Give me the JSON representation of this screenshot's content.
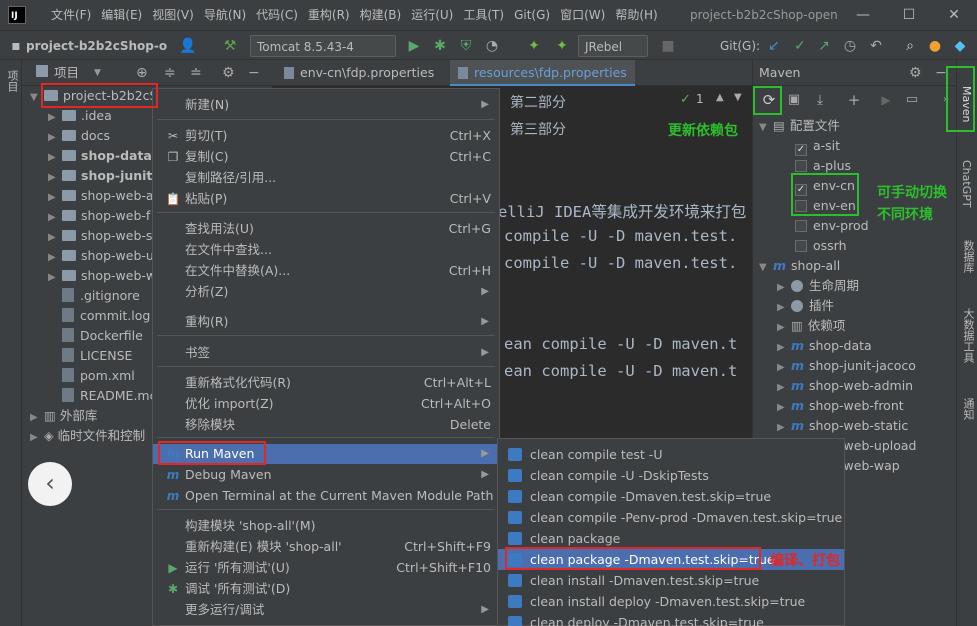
{
  "titlebar": {
    "logo": "IJ",
    "menu": [
      "文件(F)",
      "编辑(E)",
      "视图(V)",
      "导航(N)",
      "代码(C)",
      "重构(R)",
      "构建(B)",
      "运行(U)",
      "工具(T)",
      "Git(G)",
      "窗口(W)",
      "帮助(H)"
    ],
    "window_title": "project-b2b2cShop-open",
    "minimize": "—",
    "maximize": "☐",
    "close": "✕"
  },
  "toolbar": {
    "project_name": "project-b2b2cShop-ope",
    "run_config": "Tomcat 8.5.43-4",
    "jrebel": "JRebel",
    "git_label": "Git(G):"
  },
  "left_strip": {
    "project_tab": "项目"
  },
  "right_strip": {
    "maven_tab": "Maven",
    "chatgpt_tab": "ChatGPT",
    "db_tab": "数据库",
    "bigdata_tab": "大数据工具",
    "notify_tab": "通知"
  },
  "project_panel": {
    "header": "项目",
    "root": "project-b2b2cS",
    "items": [
      {
        "label": ".idea",
        "kind": "folder",
        "bold": false
      },
      {
        "label": "docs",
        "kind": "folder",
        "bold": false
      },
      {
        "label": "shop-data",
        "kind": "folder",
        "bold": true
      },
      {
        "label": "shop-junit-",
        "kind": "folder",
        "bold": true
      },
      {
        "label": "shop-web-a",
        "kind": "folder",
        "bold": false
      },
      {
        "label": "shop-web-f",
        "kind": "folder",
        "bold": false
      },
      {
        "label": "shop-web-s",
        "kind": "folder",
        "bold": false
      },
      {
        "label": "shop-web-u",
        "kind": "folder",
        "bold": false
      },
      {
        "label": "shop-web-w",
        "kind": "folder",
        "bold": false
      },
      {
        "label": ".gitignore",
        "kind": "file",
        "bold": false
      },
      {
        "label": "commit.log",
        "kind": "file",
        "bold": false
      },
      {
        "label": "Dockerfile",
        "kind": "file",
        "bold": false
      },
      {
        "label": "LICENSE",
        "kind": "file",
        "bold": false
      },
      {
        "label": "pom.xml",
        "kind": "file",
        "bold": false
      },
      {
        "label": "README.mc",
        "kind": "file",
        "bold": false
      }
    ],
    "external_libs": "外部库",
    "scratches": "临时文件和控制"
  },
  "editor": {
    "tabs": [
      {
        "label": "env-cn\\fdp.properties",
        "active": false
      },
      {
        "label": "resources\\fdp.properties",
        "active": true
      }
    ],
    "inspection_count": "1",
    "lines": [
      "第二部分",
      "第三部分",
      "elliJ IDEA等集成开发环境来打包",
      "compile -U -D maven.test.",
      "compile -U -D maven.test.",
      "ean compile -U -D maven.t",
      "ean compile -U -D maven.t"
    ]
  },
  "maven_panel": {
    "title": "Maven",
    "profiles_label": "配置文件",
    "profiles": [
      {
        "label": "a-sit",
        "checked": true
      },
      {
        "label": "a-plus",
        "checked": false
      },
      {
        "label": "env-cn",
        "checked": true
      },
      {
        "label": "env-en",
        "checked": false
      },
      {
        "label": "env-prod",
        "checked": false
      },
      {
        "label": "ossrh",
        "checked": false
      }
    ],
    "root_module": "shop-all",
    "sub_nodes": [
      "生命周期",
      "插件",
      "依赖项"
    ],
    "modules": [
      "shop-data",
      "shop-junit-jacoco",
      "shop-web-admin",
      "shop-web-front",
      "shop-web-static",
      "shop-web-upload",
      "shop-web-wap"
    ]
  },
  "context_menu": {
    "items": [
      {
        "label": "新建(N)",
        "shortcut": "",
        "submenu": true,
        "icon": ""
      },
      {
        "label": "剪切(T)",
        "shortcut": "Ctrl+X",
        "submenu": false,
        "icon": "✂"
      },
      {
        "label": "复制(C)",
        "shortcut": "Ctrl+C",
        "submenu": false,
        "icon": "❐"
      },
      {
        "label": "复制路径/引用...",
        "shortcut": "",
        "submenu": false,
        "icon": ""
      },
      {
        "label": "粘贴(P)",
        "shortcut": "Ctrl+V",
        "submenu": false,
        "icon": "📋"
      },
      {
        "label": "查找用法(U)",
        "shortcut": "Ctrl+G",
        "submenu": false,
        "icon": ""
      },
      {
        "label": "在文件中查找...",
        "shortcut": "",
        "submenu": false,
        "icon": ""
      },
      {
        "label": "在文件中替换(A)...",
        "shortcut": "Ctrl+H",
        "submenu": false,
        "icon": ""
      },
      {
        "label": "分析(Z)",
        "shortcut": "",
        "submenu": true,
        "icon": ""
      },
      {
        "label": "重构(R)",
        "shortcut": "",
        "submenu": true,
        "icon": ""
      },
      {
        "label": "书签",
        "shortcut": "",
        "submenu": true,
        "icon": ""
      },
      {
        "label": "重新格式化代码(R)",
        "shortcut": "Ctrl+Alt+L",
        "submenu": false,
        "icon": ""
      },
      {
        "label": "优化 import(Z)",
        "shortcut": "Ctrl+Alt+O",
        "submenu": false,
        "icon": ""
      },
      {
        "label": "移除模块",
        "shortcut": "Delete",
        "submenu": false,
        "icon": ""
      },
      {
        "label": "Run Maven",
        "shortcut": "",
        "submenu": true,
        "icon": "m"
      },
      {
        "label": "Debug Maven",
        "shortcut": "",
        "submenu": true,
        "icon": "m"
      },
      {
        "label": "Open Terminal at the Current Maven Module Path",
        "shortcut": "",
        "submenu": false,
        "icon": "m"
      },
      {
        "label": "构建模块 'shop-all'(M)",
        "shortcut": "",
        "submenu": false,
        "icon": ""
      },
      {
        "label": "重新构建(E) 模块 'shop-all'",
        "shortcut": "Ctrl+Shift+F9",
        "submenu": false,
        "icon": ""
      },
      {
        "label": "运行 '所有测试'(U)",
        "shortcut": "Ctrl+Shift+F10",
        "submenu": false,
        "icon": "▶"
      },
      {
        "label": "调试 '所有测试'(D)",
        "shortcut": "",
        "submenu": false,
        "icon": "✱"
      },
      {
        "label": "更多运行/调试",
        "shortcut": "",
        "submenu": true,
        "icon": ""
      }
    ]
  },
  "run_maven_submenu": {
    "items": [
      "clean compile test -U",
      "clean compile -U -DskipTests",
      "clean compile -Dmaven.test.skip=true",
      "clean compile -Penv-prod  -Dmaven.test.skip=true",
      "clean package",
      "clean package -Dmaven.test.skip=true",
      "clean install -Dmaven.test.skip=true",
      "clean install deploy -Dmaven.test.skip=true",
      "clean deploy -Dmaven.test.skip=true"
    ]
  },
  "annotations": {
    "refresh_deps": "更新依赖包",
    "switch_env_1": "可手动切换",
    "switch_env_2": "不同环境",
    "compile_package": "编译、打包"
  },
  "colors": {
    "annotation_green": "#2cbf2c",
    "annotation_red": "#e32626",
    "selection_blue": "#4b6eaf"
  }
}
